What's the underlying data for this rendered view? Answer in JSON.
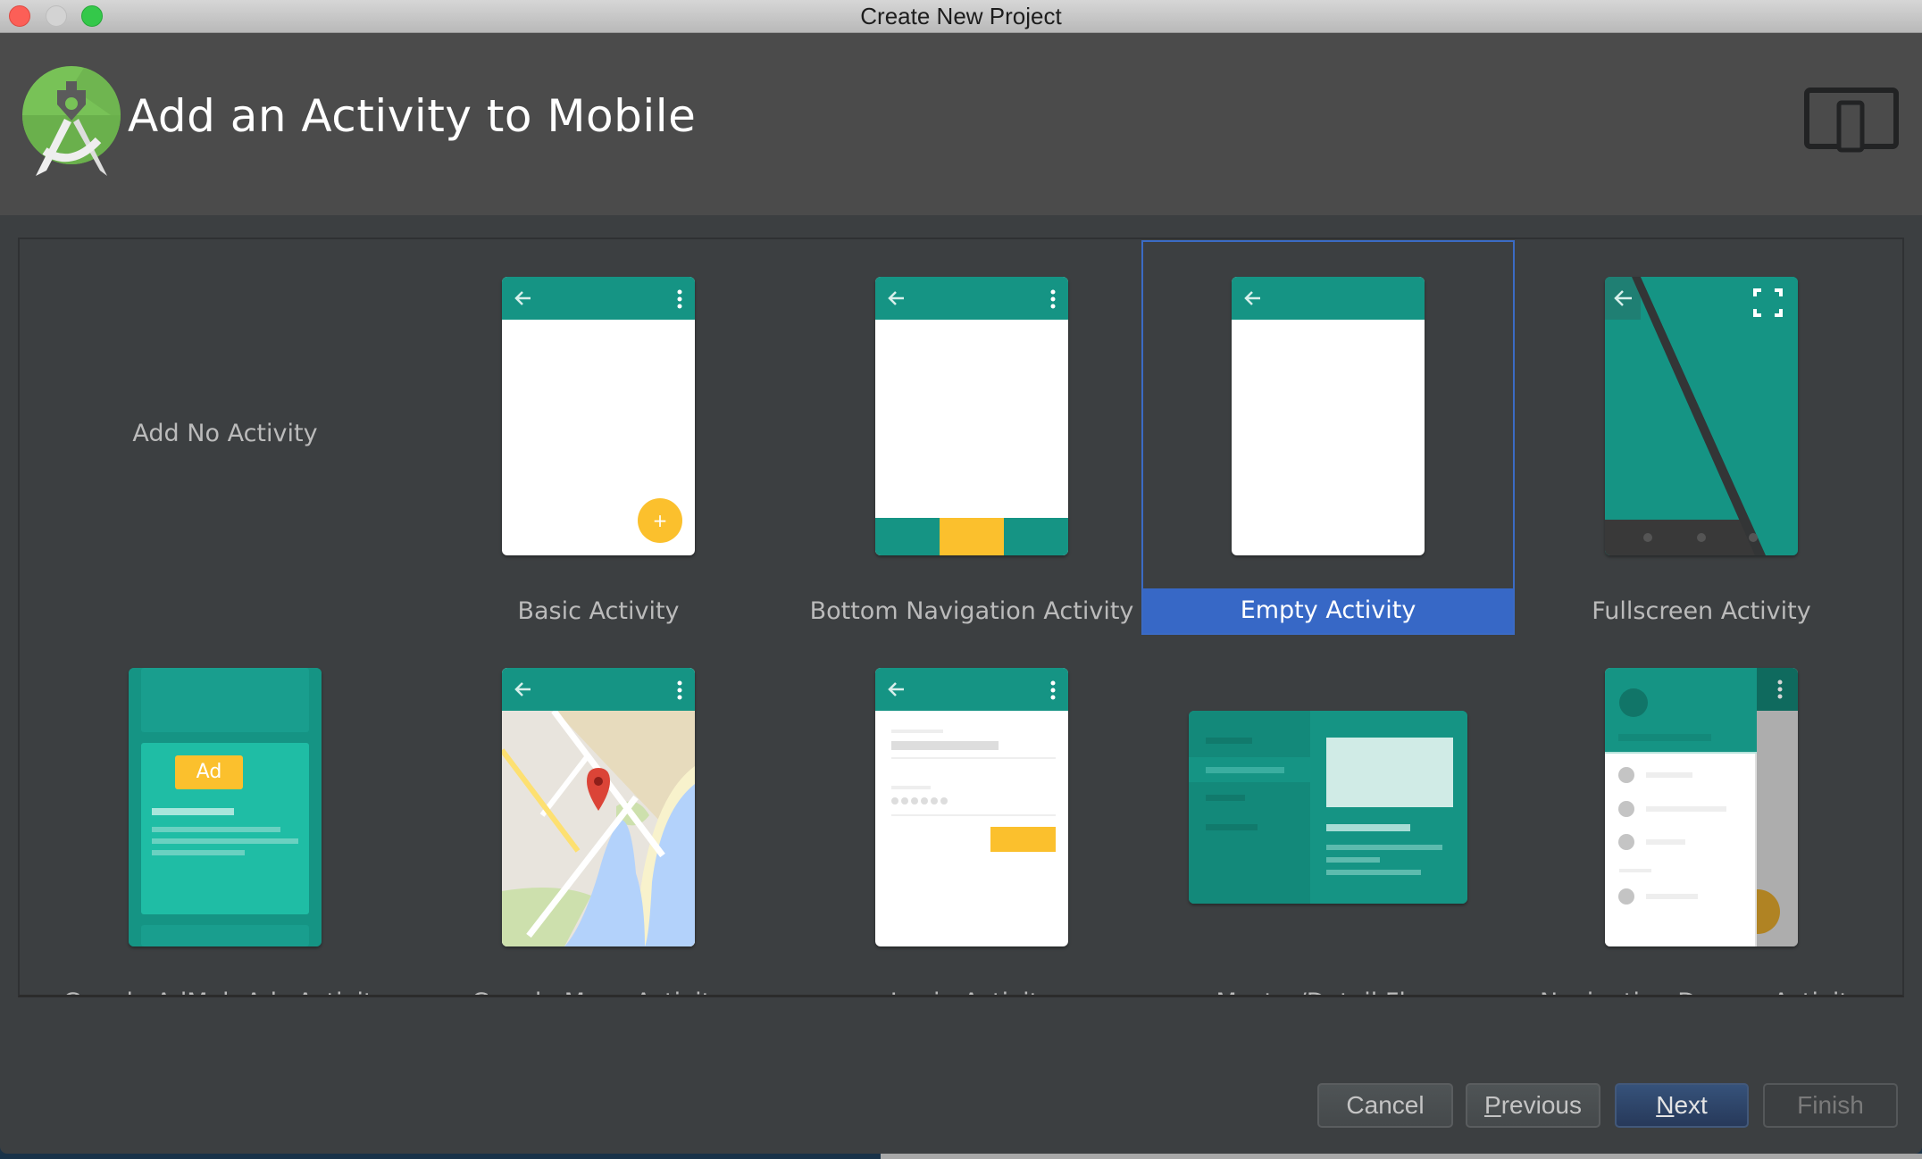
{
  "window": {
    "title": "Create New Project"
  },
  "header": {
    "title": "Add an Activity to Mobile",
    "logo": "android-studio-logo",
    "form_factor_icon": "phone-and-tablet-icon"
  },
  "gallery": {
    "selected": "Empty Activity",
    "items": [
      {
        "label": "Add No Activity",
        "preview": "none"
      },
      {
        "label": "Basic Activity",
        "preview": "basic"
      },
      {
        "label": "Bottom Navigation Activity",
        "preview": "bottom-navigation"
      },
      {
        "label": "Empty Activity",
        "preview": "empty",
        "selected": true
      },
      {
        "label": "Fullscreen Activity",
        "preview": "fullscreen"
      },
      {
        "label": "Google AdMob Ads Activity",
        "preview": "admob",
        "clipped": true
      },
      {
        "label": "Google Maps Activity",
        "preview": "maps",
        "clipped": true
      },
      {
        "label": "Login Activity",
        "preview": "login",
        "clipped": true
      },
      {
        "label": "Master/Detail Flow",
        "preview": "master-detail",
        "clipped": true
      },
      {
        "label": "Navigation Drawer Activity",
        "preview": "navigation-drawer",
        "clipped": true
      }
    ],
    "ad_badge": "Ad",
    "fab_symbol": "+"
  },
  "footer": {
    "cancel": "Cancel",
    "previous_mnemonic": "P",
    "previous_rest": "revious",
    "next_mnemonic": "N",
    "next_rest": "ext",
    "finish": "Finish"
  },
  "colors": {
    "accent_teal": "#159484",
    "fab_yellow": "#fbc02d",
    "selection_blue": "#3768c6",
    "primary_button": "#2f4569"
  }
}
